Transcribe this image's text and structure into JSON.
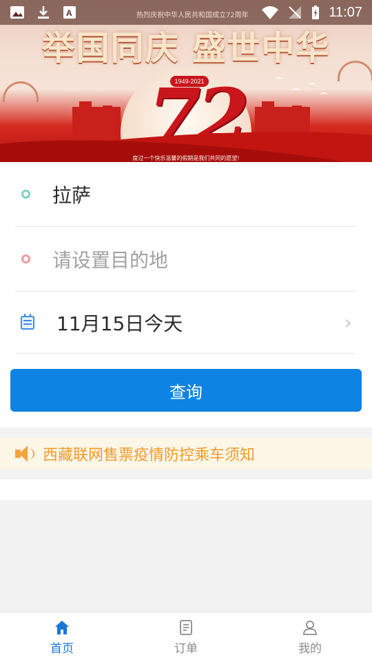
{
  "status_bar": {
    "time": "11:07",
    "banner_scroll_text": "热烈庆祝中华人民共和国成立72周年"
  },
  "banner": {
    "title": "举国同庆 盛世中华",
    "years_badge": "1949-2021",
    "anniversary_number": "72",
    "caption": "度过一个快乐温馨的假期是我们共同的愿望!"
  },
  "form": {
    "from_value": "拉萨",
    "to_placeholder": "请设置目的地",
    "date_value": "11月15日今天",
    "query_button": "查询"
  },
  "notice": {
    "text": "西藏联网售票疫情防控乘车须知"
  },
  "tabbar": {
    "items": [
      {
        "label": "首页",
        "icon": "home-icon",
        "active": true
      },
      {
        "label": "订单",
        "icon": "document-icon",
        "active": false
      },
      {
        "label": "我的",
        "icon": "user-icon",
        "active": false
      }
    ]
  },
  "colors": {
    "primary": "#0d84e4",
    "tab_active": "#1677d9",
    "notice_text": "#f39a2b",
    "notice_bg": "#fdf7e8",
    "from_dot": "#7dd3c2",
    "to_dot": "#f29aa2"
  }
}
